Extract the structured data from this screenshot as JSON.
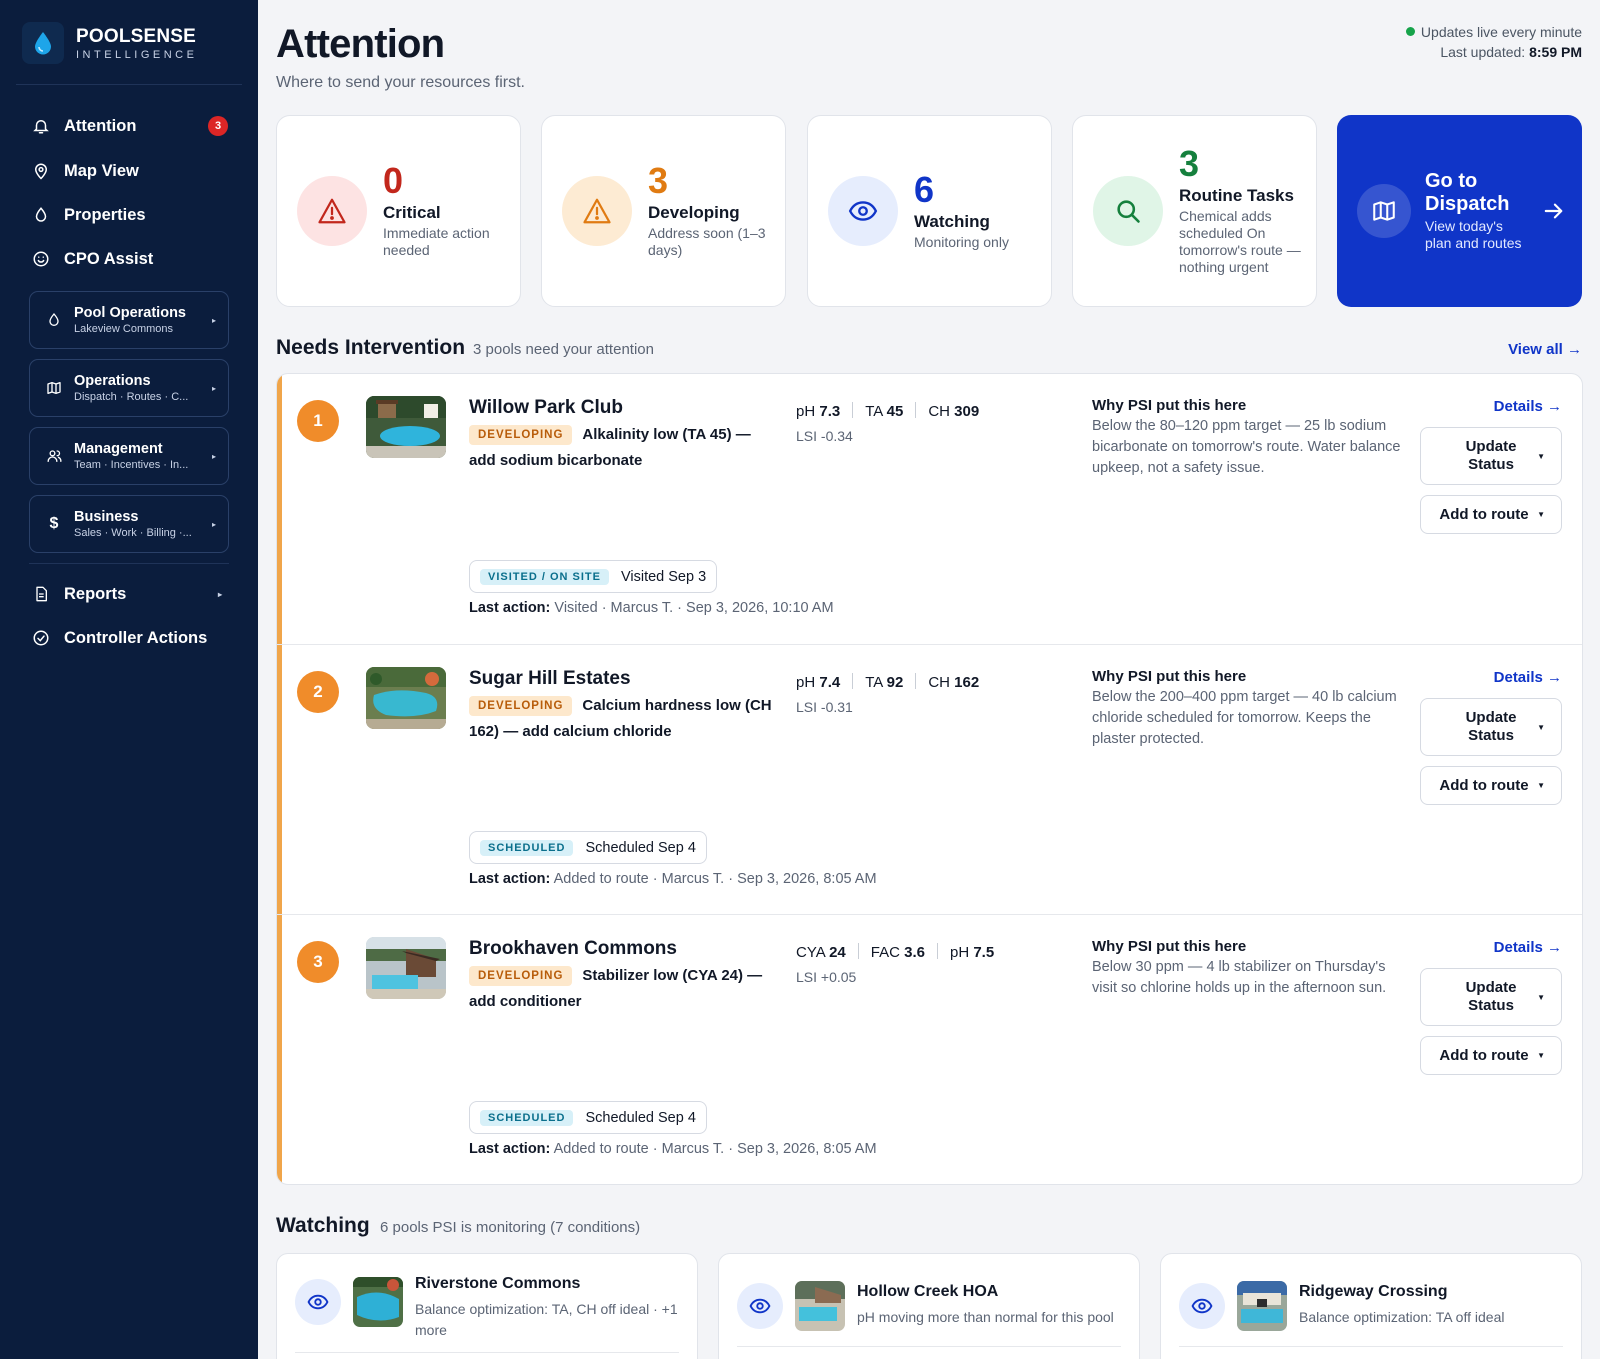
{
  "brand": {
    "name": "POOLSENSE",
    "sub": "INTELLIGENCE"
  },
  "nav": {
    "attention": {
      "label": "Attention",
      "badge": "3"
    },
    "map": {
      "label": "Map View"
    },
    "properties": {
      "label": "Properties"
    },
    "cpo": {
      "label": "CPO Assist"
    },
    "reports": {
      "label": "Reports"
    },
    "controller": {
      "label": "Controller Actions"
    }
  },
  "groups": [
    {
      "title": "Pool Operations",
      "sub": "Lakeview Commons"
    },
    {
      "title": "Operations",
      "sub": "Dispatch · Routes · C..."
    },
    {
      "title": "Management",
      "sub": "Team · Incentives · In..."
    },
    {
      "title": "Business",
      "sub": "Sales · Work · Billing ·..."
    }
  ],
  "header": {
    "title": "Attention",
    "subtitle": "Where to send your resources first.",
    "live": "Updates live every minute",
    "updated_label": "Last updated:",
    "updated_time": "8:59 PM"
  },
  "stats": [
    {
      "num": "0",
      "label": "Critical",
      "desc": "Immediate action needed",
      "color": "#c2271c"
    },
    {
      "num": "3",
      "label": "Developing",
      "desc": "Address soon (1–3 days)",
      "color": "#e07b12"
    },
    {
      "num": "6",
      "label": "Watching",
      "desc": "Monitoring only",
      "color": "#1035c8"
    },
    {
      "num": "3",
      "label": "Routine Tasks",
      "desc": "Chemical adds scheduled On tomorrow's route — nothing urgent",
      "color": "#15803d"
    }
  ],
  "dispatch": {
    "title": "Go to Dispatch",
    "desc": "View today's plan and routes"
  },
  "intervention": {
    "title": "Needs Intervention",
    "sub": "3 pools need your attention",
    "view_all": "View all →",
    "rows": [
      {
        "rank": "1",
        "name": "Willow Park Club",
        "severity": "DEVELOPING",
        "issue": "Alkalinity low (TA 45) — add sodium bicarbonate",
        "metrics": [
          {
            "k": "pH",
            "v": "7.3"
          },
          {
            "k": "TA",
            "v": "45"
          },
          {
            "k": "CH",
            "v": "309"
          }
        ],
        "lsi": "LSI -0.34",
        "why_title": "Why PSI put this here",
        "why": "Below the 80–120 ppm target — 25 lb sodium bicarbonate on tomorrow's route. Water balance upkeep, not a safety issue.",
        "details": "Details →",
        "update": "Update Status",
        "add": "Add to route",
        "status_pill": "VISITED / ON SITE",
        "status_text": "Visited Sep 3",
        "last_label": "Last action:",
        "last": "Visited · Marcus T. · Sep 3, 2026, 10:10 AM"
      },
      {
        "rank": "2",
        "name": "Sugar Hill Estates",
        "severity": "DEVELOPING",
        "issue": "Calcium hardness low (CH 162) — add calcium chloride",
        "metrics": [
          {
            "k": "pH",
            "v": "7.4"
          },
          {
            "k": "TA",
            "v": "92"
          },
          {
            "k": "CH",
            "v": "162"
          }
        ],
        "lsi": "LSI -0.31",
        "why_title": "Why PSI put this here",
        "why": "Below the 200–400 ppm target — 40 lb calcium chloride scheduled for tomorrow. Keeps the plaster protected.",
        "details": "Details →",
        "update": "Update Status",
        "add": "Add to route",
        "status_pill": "SCHEDULED",
        "status_text": "Scheduled Sep 4",
        "last_label": "Last action:",
        "last": "Added to route · Marcus T. · Sep 3, 2026, 8:05 AM"
      },
      {
        "rank": "3",
        "name": "Brookhaven Commons",
        "severity": "DEVELOPING",
        "issue": "Stabilizer low (CYA 24) — add conditioner",
        "metrics": [
          {
            "k": "CYA",
            "v": "24"
          },
          {
            "k": "FAC",
            "v": "3.6"
          },
          {
            "k": "pH",
            "v": "7.5"
          }
        ],
        "lsi": "LSI +0.05",
        "why_title": "Why PSI put this here",
        "why": "Below 30 ppm — 4 lb stabilizer on Thursday's visit so chlorine holds up in the afternoon sun.",
        "details": "Details →",
        "update": "Update Status",
        "add": "Add to route",
        "status_pill": "SCHEDULED",
        "status_text": "Scheduled Sep 4",
        "last_label": "Last action:",
        "last": "Added to route · Marcus T. · Sep 3, 2026, 8:05 AM"
      }
    ]
  },
  "watching": {
    "title": "Watching",
    "sub": "6 pools PSI is monitoring (7 conditions)",
    "cards": [
      {
        "name": "Riverstone Commons",
        "desc": "Balance optimization: TA, CH off ideal · +1 more"
      },
      {
        "name": "Hollow Creek HOA",
        "desc": "pH moving more than normal for this pool"
      },
      {
        "name": "Ridgeway Crossing",
        "desc": "Balance optimization: TA off ideal"
      }
    ]
  }
}
